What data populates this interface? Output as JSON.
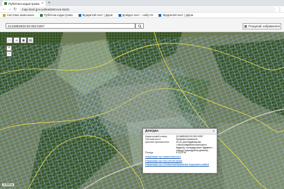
{
  "browser": {
    "tab_title": "Публічна кадастрова карта Укр",
    "tab_close": "×",
    "new_tab": "+",
    "url": "map.land.gov.ua/kadastrova-karta",
    "menu": "⋮",
    "bookmarks": [
      {
        "label": "Система земельних",
        "icon": "bookmark-icon"
      },
      {
        "label": "Публічна кадастрова",
        "icon": "map-icon"
      },
      {
        "label": "Відкритий лист | Держ",
        "icon": "doc-icon"
      },
      {
        "label": "Довідка лист - набуття",
        "icon": "doc-icon"
      },
      {
        "label": "Відкритий лист | Держ",
        "icon": "doc-icon"
      }
    ]
  },
  "search": {
    "value": "2124882603:02:002:0267",
    "button_icon": "search-icon"
  },
  "toolbar": {
    "cadastre_label": "Пошукові зображення",
    "tools": [
      "▭",
      "⊿",
      "◉",
      "▤"
    ],
    "zoom_in": "+",
    "zoom_out": "−"
  },
  "popup": {
    "title": "Довідка",
    "close": "×",
    "rows": [
      {
        "k": "Кадастровий номер:",
        "v": "2124882603:02:002:0267"
      },
      {
        "k": "Тип власності:",
        "v": "Приватна власність"
      },
      {
        "k": "Цільове призначення:",
        "v": "02.01 Для будівництва"
      },
      {
        "k": "",
        "v": "і обслуговування житлового будинку, господарських будівель і споруд (присадибна ділянка)"
      },
      {
        "k": "Площа:",
        "v": "0.1123 га"
      }
    ],
    "links": [
      "Інформація про права власності",
      "Інформація про інші речові права",
      "Інформація про обтяження/обмеження нерухомого майна"
    ]
  },
  "scale": "0     200 м"
}
